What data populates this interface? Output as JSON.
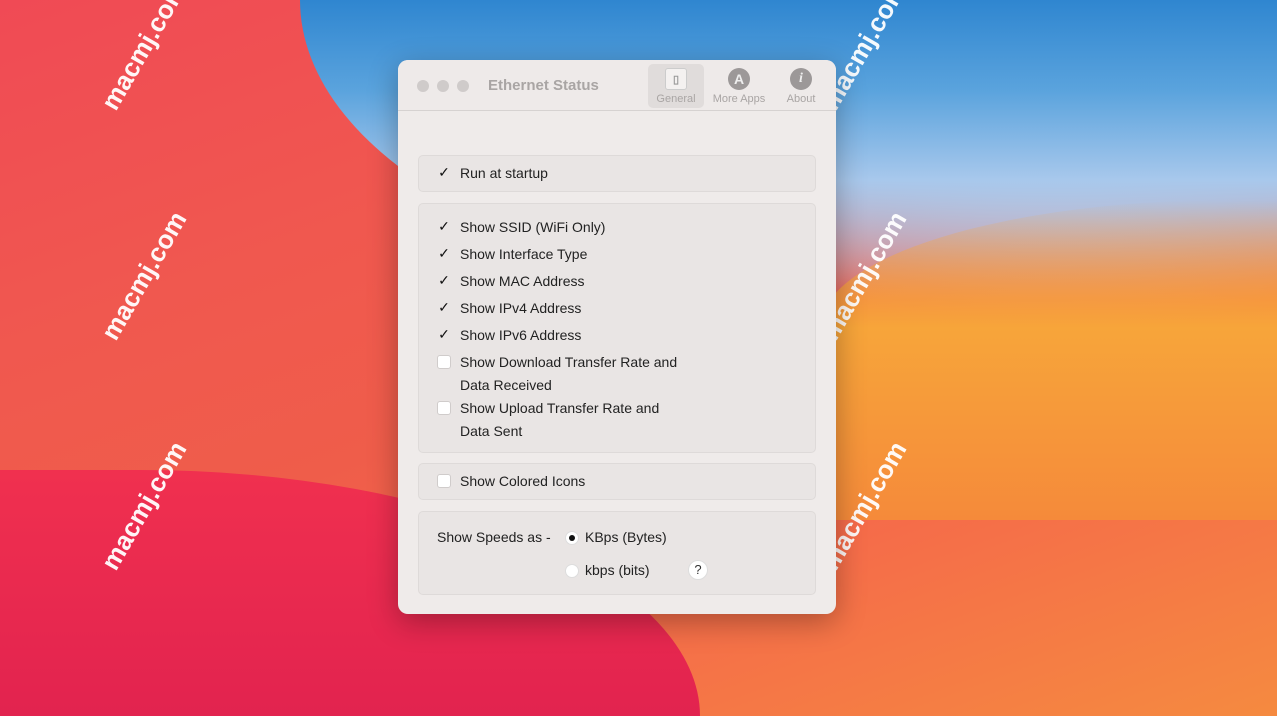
{
  "watermark": "macmj.com",
  "window": {
    "title": "Ethernet Status",
    "tabs": [
      {
        "label": "General",
        "icon": "phone-icon"
      },
      {
        "label": "More Apps",
        "icon": "app-store-icon"
      },
      {
        "label": "About",
        "icon": "info-icon"
      }
    ]
  },
  "general": {
    "run_at_startup": {
      "label": "Run at startup",
      "checked": true
    },
    "display_options": [
      {
        "label": "Show SSID (WiFi Only)",
        "checked": true
      },
      {
        "label": "Show Interface Type",
        "checked": true
      },
      {
        "label": "Show MAC Address",
        "checked": true
      },
      {
        "label": "Show IPv4 Address",
        "checked": true
      },
      {
        "label": "Show IPv6 Address",
        "checked": true
      },
      {
        "label": "Show Download Transfer Rate and",
        "label2": "Data Received",
        "checked": false
      },
      {
        "label": "Show Upload Transfer Rate and",
        "label2": "Data Sent",
        "checked": false
      }
    ],
    "colored_icons": {
      "label": "Show Colored Icons",
      "checked": false
    },
    "speeds": {
      "label": "Show Speeds as -",
      "options": [
        {
          "label": "KBps (Bytes)",
          "selected": true
        },
        {
          "label": "kbps (bits)",
          "selected": false
        }
      ],
      "help": "?"
    }
  }
}
